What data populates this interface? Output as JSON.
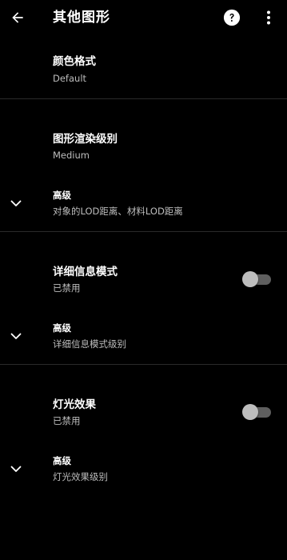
{
  "app_bar": {
    "title": "其他图形",
    "back_icon": "arrow-back-icon",
    "help_icon": "help-circle-icon",
    "menu_icon": "more-vert-icon"
  },
  "colors": {
    "background": "#000000",
    "text_primary": "#ffffff",
    "text_secondary": "#bdbdbd",
    "divider": "#2a2a2a",
    "switch_track_off": "#5f5f5f",
    "switch_thumb_off": "#bdbdbd"
  },
  "preferences": [
    {
      "title": "颜色格式",
      "summary": "Default"
    },
    {
      "title": "图形渲染级别",
      "summary": "Medium"
    },
    {
      "advanced_title": "高级",
      "advanced_summary": "对象的LOD距离、材料LOD距离"
    },
    {
      "title": "详细信息模式",
      "summary": "已禁用",
      "switch_on": false
    },
    {
      "advanced_title": "高级",
      "advanced_summary": "详细信息模式级别"
    },
    {
      "title": "灯光效果",
      "summary": "已禁用",
      "switch_on": false
    },
    {
      "advanced_title": "高级",
      "advanced_summary": "灯光效果级别"
    }
  ]
}
